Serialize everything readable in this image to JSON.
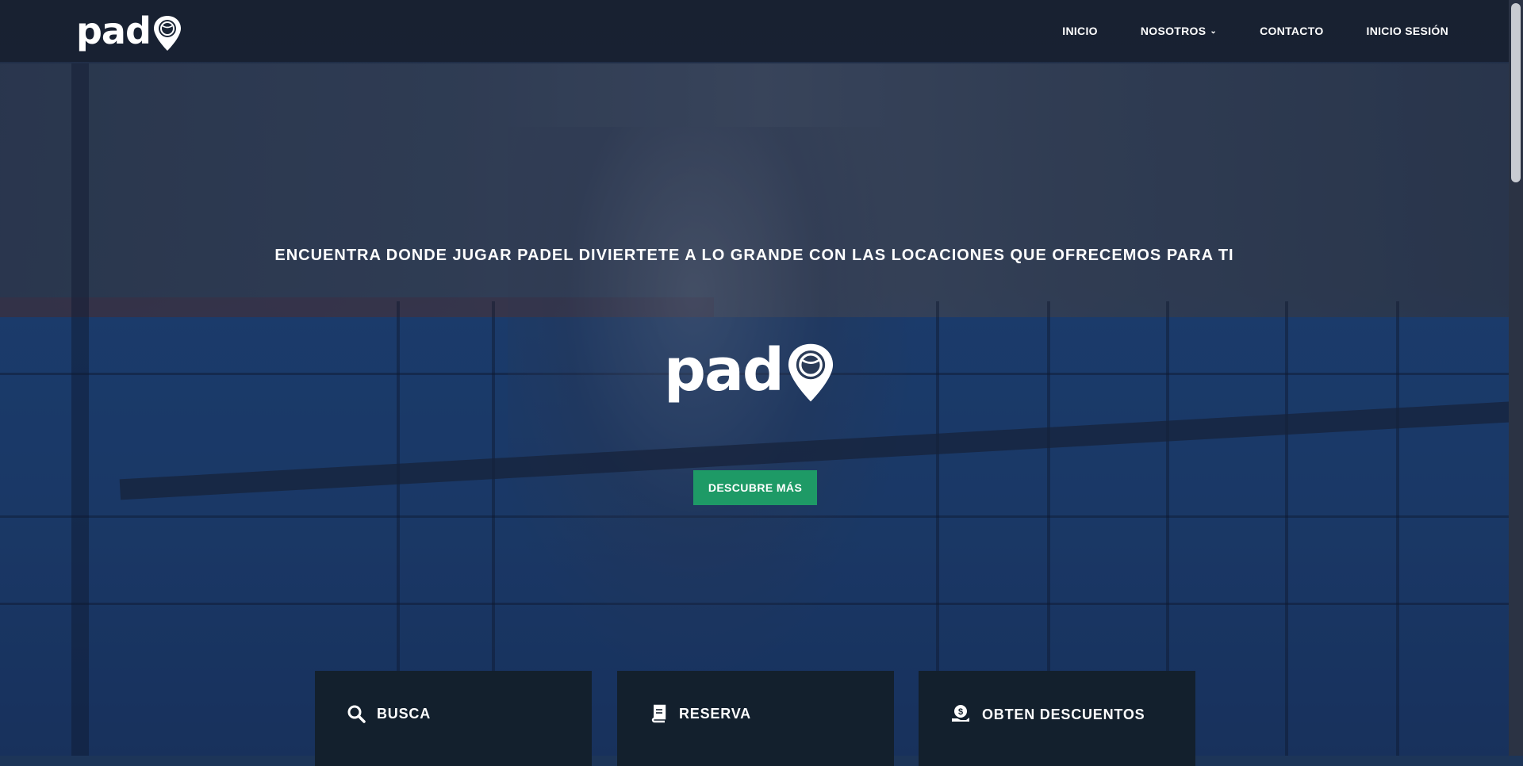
{
  "header": {
    "logo_text": "pad",
    "nav": [
      {
        "label": "INICIO"
      },
      {
        "label": "NOSOTROS"
      },
      {
        "label": "CONTACTO"
      },
      {
        "label": "INICIO SESIÓN"
      }
    ]
  },
  "hero": {
    "tagline": "ENCUENTRA DONDE JUGAR PADEL DIVIERTETE A LO GRANDE CON LAS LOCACIONES QUE OFRECEMOS PARA TI",
    "logo_text": "pad",
    "cta_label": "DESCUBRE MÁS"
  },
  "features": [
    {
      "title": "BUSCA",
      "icon": "search-icon"
    },
    {
      "title": "RESERVA",
      "icon": "book-icon"
    },
    {
      "title": "OBTEN DESCUENTOS",
      "icon": "coin-hand-icon"
    }
  ],
  "colors": {
    "accent": "#1e9a66",
    "header_bg": "#161e2c",
    "card_bg": "#13202d"
  }
}
